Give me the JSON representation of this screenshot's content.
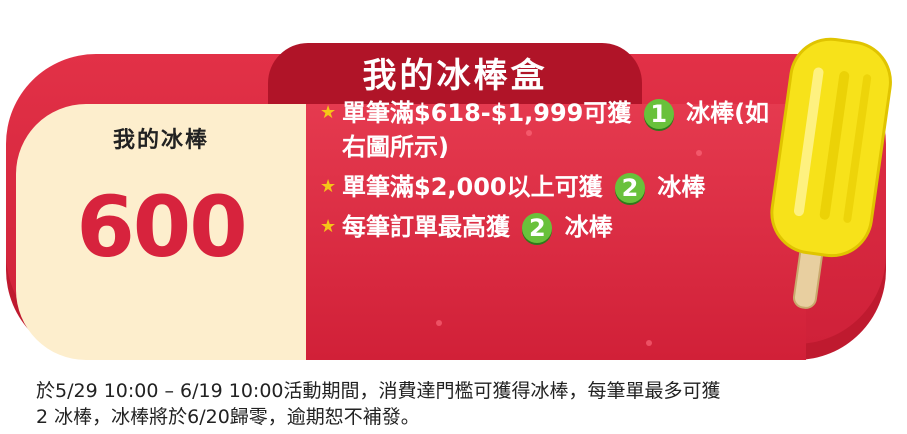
{
  "box": {
    "title": "我的冰棒盒",
    "left_label": "我的冰棒",
    "left_value": "600"
  },
  "rules": [
    {
      "text_before": "單筆滿$618-$1,999可獲",
      "badge": "1",
      "text_after": "冰棒(如右圖所示)"
    },
    {
      "text_before": "單筆滿$2,000以上可獲",
      "badge": "2",
      "text_after": "冰棒"
    },
    {
      "text_before": "每筆訂單最高獲",
      "badge": "2",
      "text_after": "冰棒"
    }
  ],
  "footer": {
    "line1": "於5/29 10:00 – 6/19 10:00活動期間，消費達門檻可獲得冰棒，每筆單最多可獲",
    "line2": " 2 冰棒，冰棒將於6/20歸零，逾期恕不補發。"
  },
  "icons": {
    "bullet": "star-icon",
    "decor": "popsicle-icon"
  },
  "colors": {
    "primary_red": "#d7233d",
    "cream": "#fdeecd",
    "badge_green": "#69c13b",
    "star": "#f5c518",
    "popsicle_yellow": "#f7e21a"
  }
}
